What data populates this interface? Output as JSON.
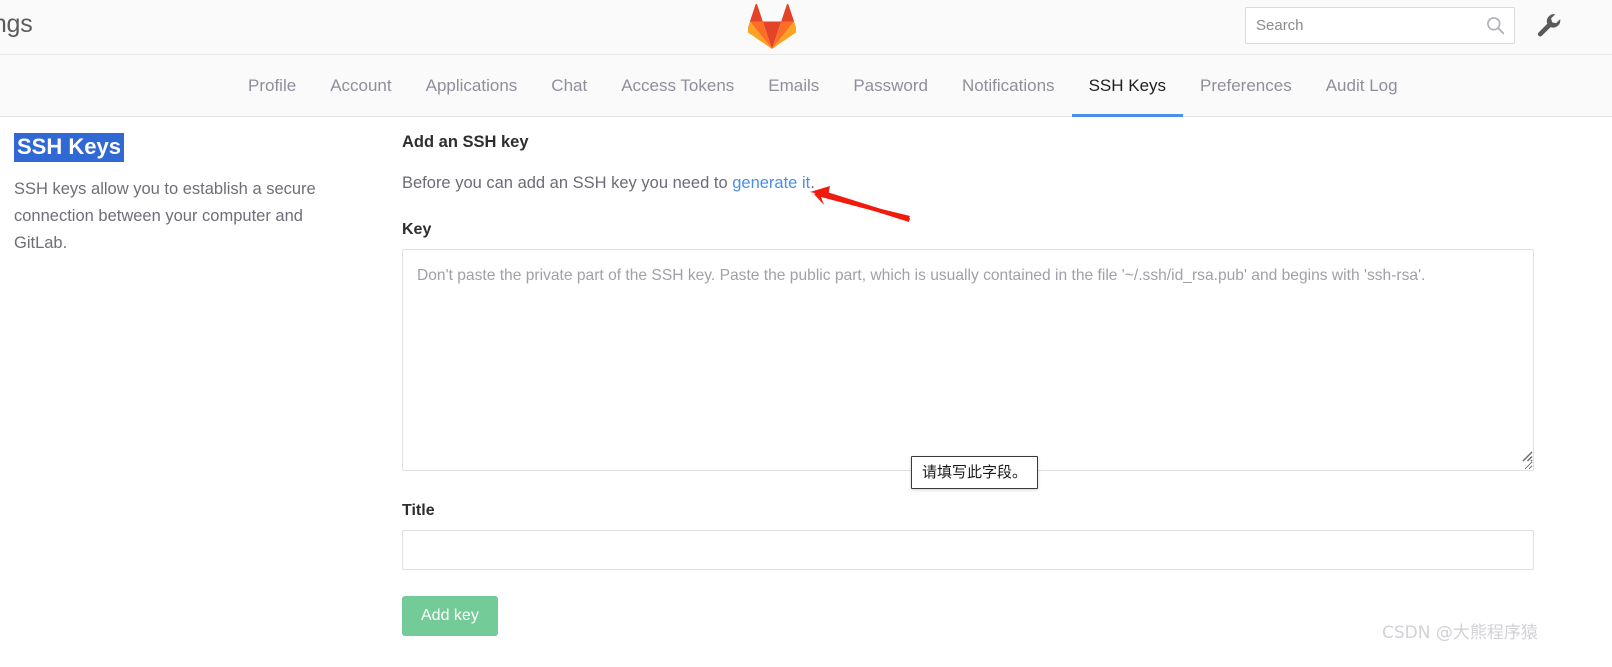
{
  "header": {
    "page_title_visible": "ttings",
    "logo_name": "gitlab-tanuki-logo",
    "search": {
      "placeholder": "Search",
      "value": ""
    },
    "admin_icon_name": "wrench-icon"
  },
  "nav": {
    "items": [
      {
        "label": "Profile",
        "active": false
      },
      {
        "label": "Account",
        "active": false
      },
      {
        "label": "Applications",
        "active": false
      },
      {
        "label": "Chat",
        "active": false
      },
      {
        "label": "Access Tokens",
        "active": false
      },
      {
        "label": "Emails",
        "active": false
      },
      {
        "label": "Password",
        "active": false
      },
      {
        "label": "Notifications",
        "active": false
      },
      {
        "label": "SSH Keys",
        "active": true
      },
      {
        "label": "Preferences",
        "active": false
      },
      {
        "label": "Audit Log",
        "active": false
      }
    ],
    "active_underline_color": "#4a8fe8"
  },
  "sidebar": {
    "heading": "SSH Keys",
    "heading_selected": true,
    "heading_selection_color": "#3068d4",
    "description": "SSH keys allow you to establish a secure connection between your computer and GitLab."
  },
  "main": {
    "heading": "Add an SSH key",
    "lead_prefix": "Before you can add an SSH key you need to ",
    "lead_link": "generate it",
    "lead_suffix": ".",
    "key_label": "Key",
    "key_placeholder": "Don't paste the private part of the SSH key. Paste the public part, which is usually contained in the file '~/.ssh/id_rsa.pub' and begins with 'ssh-rsa'.",
    "key_value": "",
    "title_label": "Title",
    "title_placeholder": "",
    "title_value": "",
    "submit_label": "Add key",
    "submit_color": "#73cb98"
  },
  "validation_tooltip": {
    "text": "请填写此字段。"
  },
  "annotation": {
    "arrow_color": "#f01a0d",
    "points_at": "generate it"
  },
  "watermark": {
    "text": "CSDN @大熊程序猿"
  }
}
